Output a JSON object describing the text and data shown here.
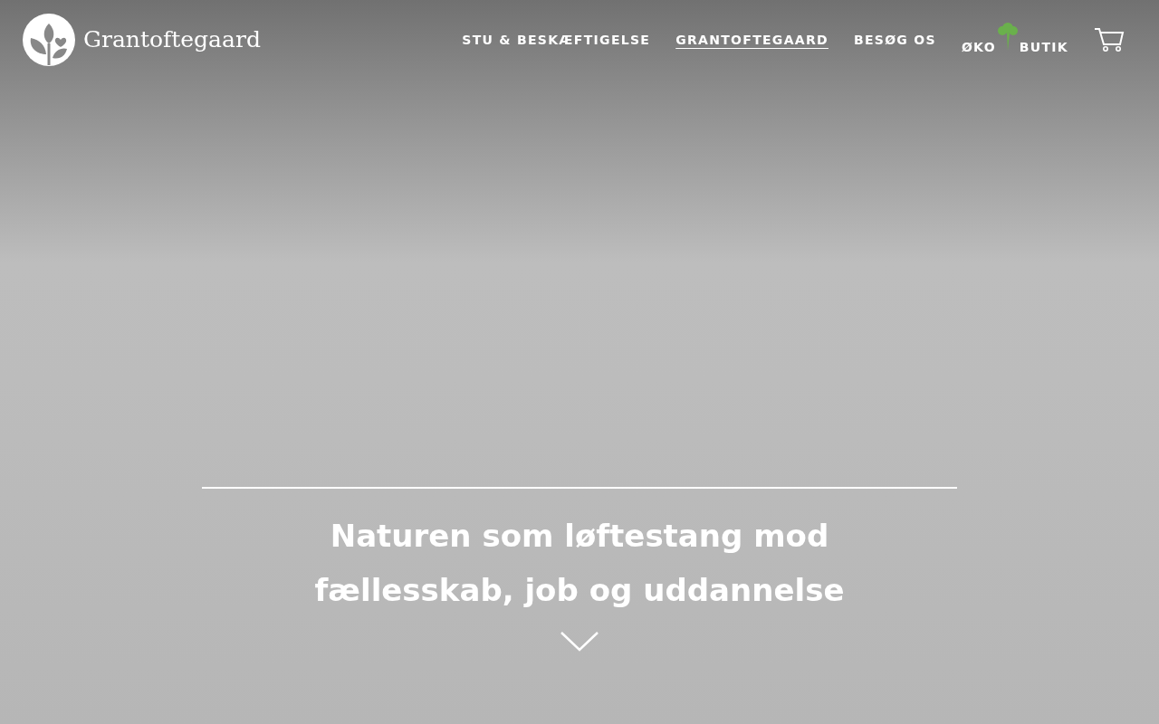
{
  "logo": {
    "text": "Grantoftegaard"
  },
  "nav": [
    {
      "kind": "text",
      "label": "STU & BESKÆFTIGELSE",
      "selected": false
    },
    {
      "kind": "text",
      "label": "GRANTOFTEGAARD",
      "selected": true
    },
    {
      "kind": "text",
      "label": "BESØG OS",
      "selected": false
    },
    {
      "kind": "split",
      "parts": [
        "ØKO",
        "BUTIK"
      ],
      "selected": false
    }
  ],
  "hero": {
    "title": "Naturen som løftestang mod fællesskab, job og uddannelse"
  }
}
